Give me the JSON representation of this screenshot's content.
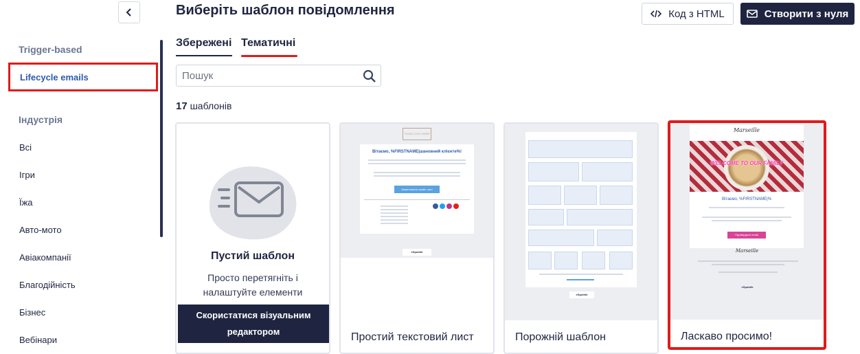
{
  "sidebar": {
    "trigger_label": "Trigger-based",
    "active_item": "Lifecycle emails",
    "industry_label": "Індустрія",
    "items": [
      "Всі",
      "Ігри",
      "Їжа",
      "Авто-мото",
      "Авіакомпанії",
      "Благодійність",
      "Бізнес",
      "Вебінари"
    ]
  },
  "header": {
    "title": "Виберіть шаблон повідомлення",
    "html_button": "Код з HTML",
    "create_button": "Створити з нуля"
  },
  "tabs": [
    "Збережені",
    "Тематичні"
  ],
  "search": {
    "placeholder": "Пошук"
  },
  "count": {
    "number": "17",
    "label": "шаблонів"
  },
  "cards": {
    "blank": {
      "title": "Пустий шаблон",
      "description": "Просто перетягніть і налаштуйте елементи",
      "button": "Скористатися візуальним редактором"
    },
    "simple_text": {
      "caption": "Простий текстовий лист",
      "logo": "YOUR LOGO HERE",
      "heading": "Вітаємо, %FIRSTNAME|шановний клієнте%!",
      "button": "Завантажити прайс-лист",
      "brand": "eSputnik"
    },
    "empty": {
      "caption": "Порожній шаблон",
      "brand": "eSputnik"
    },
    "welcome": {
      "caption": "Ласкаво просимо!",
      "brand_name": "Marseille",
      "banner": "WELCOME TO OUR FAMILY",
      "greeting": "Вітаємо, %FIRSTNAME|%",
      "button": "Підтвердити email",
      "brand": "eSputnik"
    }
  },
  "colors": {
    "primary": "#1f2540",
    "accent_red": "#e01a1a",
    "link_blue": "#2d5aa8"
  }
}
